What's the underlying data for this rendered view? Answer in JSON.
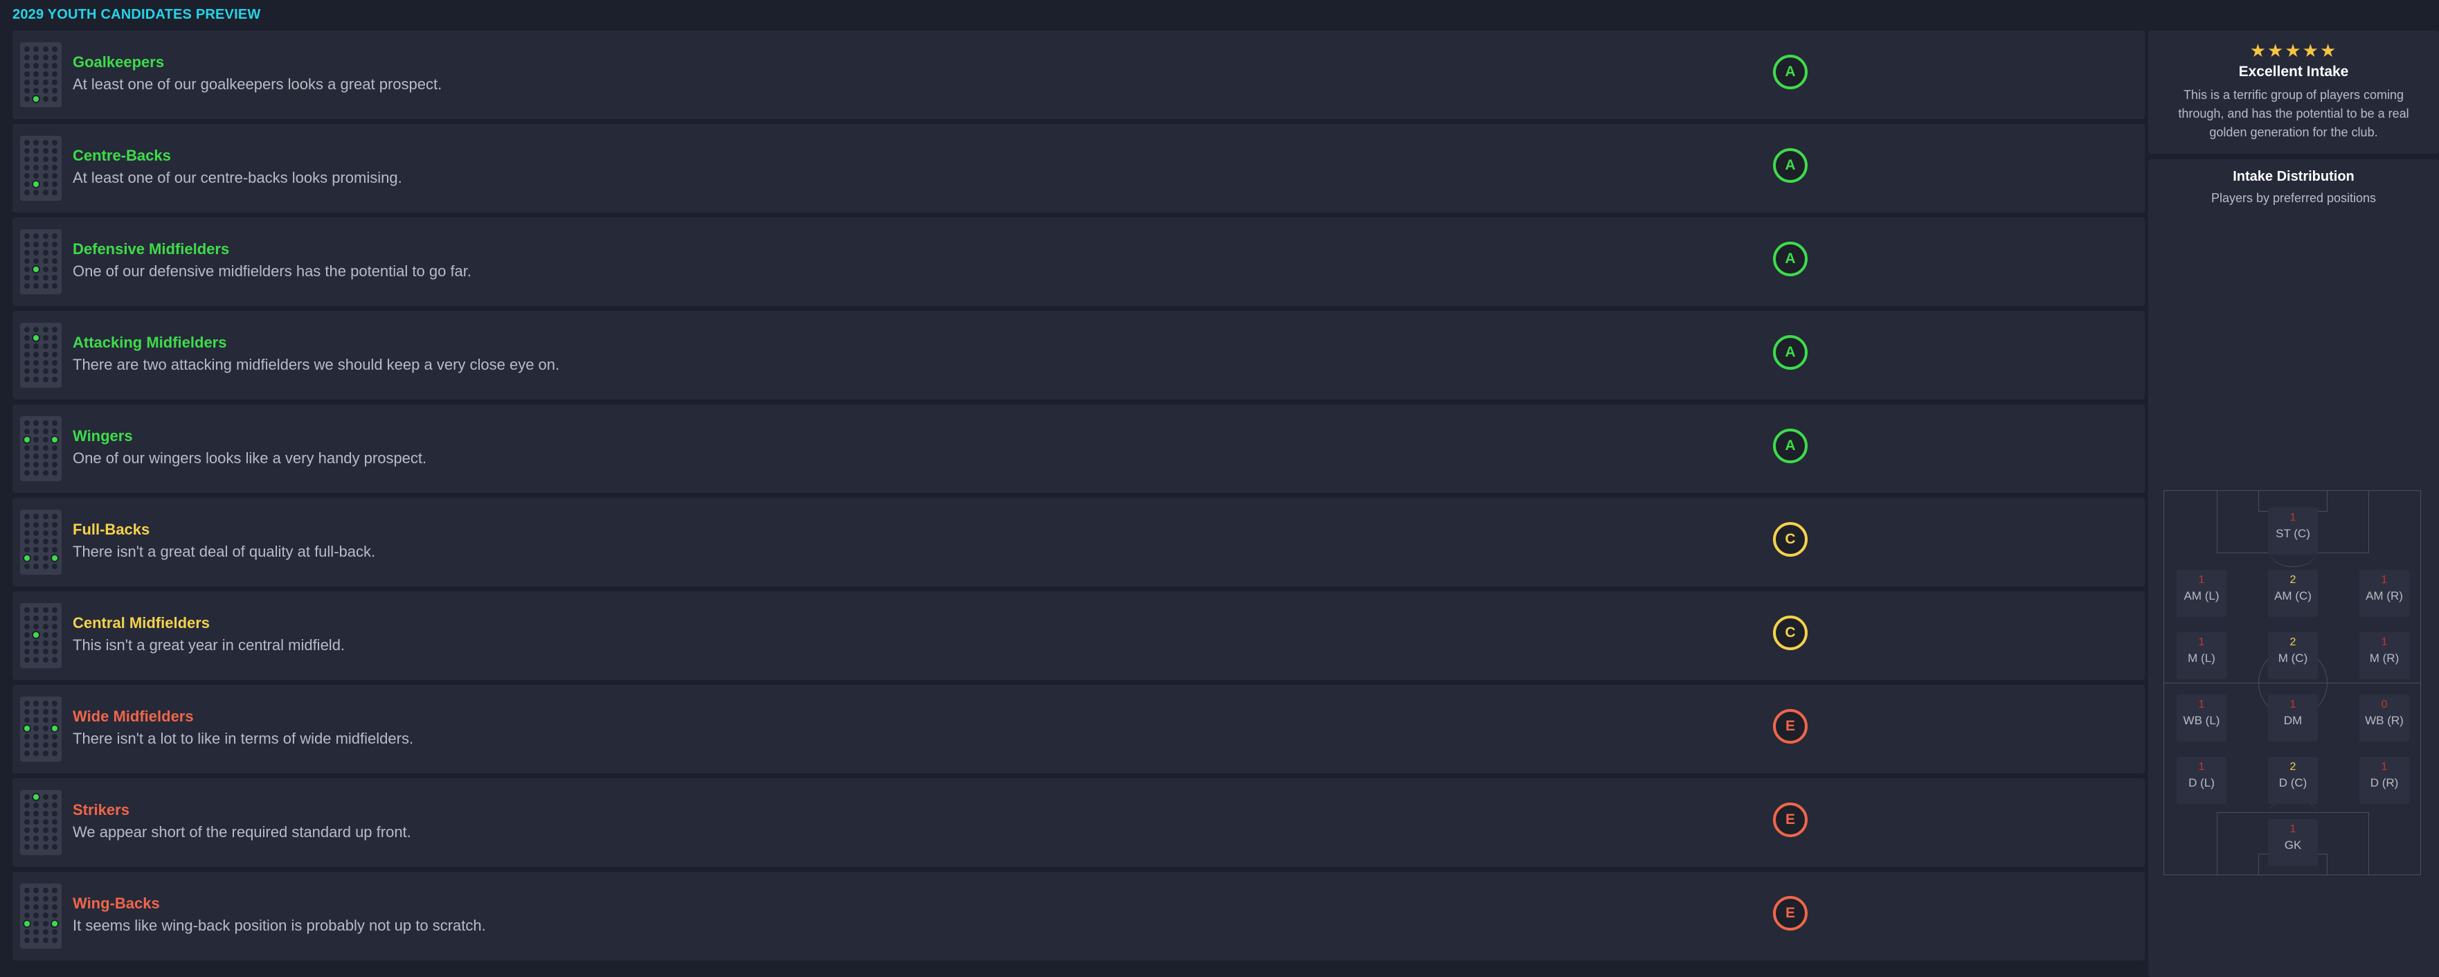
{
  "page_title": "2029 YOUTH CANDIDATES PREVIEW",
  "colors": {
    "green": "#3ddc4a",
    "yellow": "#f5d24b",
    "red": "#f0664a",
    "cyan": "#25d4e8"
  },
  "positions": [
    {
      "title": "Goalkeepers",
      "desc": "At least one of our goalkeepers looks a great prospect.",
      "grade": "A",
      "tone": "green",
      "icon": "pitch-gk-icon"
    },
    {
      "title": "Centre-Backs",
      "desc": "At least one of our centre-backs looks promising.",
      "grade": "A",
      "tone": "green",
      "icon": "pitch-cb-icon"
    },
    {
      "title": "Defensive Midfielders",
      "desc": "One of our defensive midfielders has the potential to go far.",
      "grade": "A",
      "tone": "green",
      "icon": "pitch-dm-icon"
    },
    {
      "title": "Attacking Midfielders",
      "desc": "There are two attacking midfielders we should keep a very close eye on.",
      "grade": "A",
      "tone": "green",
      "icon": "pitch-am-icon"
    },
    {
      "title": "Wingers",
      "desc": "One of our wingers looks like a very handy prospect.",
      "grade": "A",
      "tone": "green",
      "icon": "pitch-winger-icon"
    },
    {
      "title": "Full-Backs",
      "desc": "There isn't a great deal of quality at full-back.",
      "grade": "C",
      "tone": "yellow",
      "icon": "pitch-fb-icon"
    },
    {
      "title": "Central Midfielders",
      "desc": "This isn't a great year in central midfield.",
      "grade": "C",
      "tone": "yellow",
      "icon": "pitch-cm-icon"
    },
    {
      "title": "Wide Midfielders",
      "desc": "There isn't a lot to like in terms of wide midfielders.",
      "grade": "E",
      "tone": "red",
      "icon": "pitch-wm-icon"
    },
    {
      "title": "Strikers",
      "desc": "We appear short of the required standard up front.",
      "grade": "E",
      "tone": "red",
      "icon": "pitch-st-icon"
    },
    {
      "title": "Wing-Backs",
      "desc": "It seems like wing-back position is probably not up to scratch.",
      "grade": "E",
      "tone": "red",
      "icon": "pitch-wb-icon"
    }
  ],
  "intake": {
    "stars": "★★★★★",
    "rating": 5,
    "title": "Excellent Intake",
    "desc": "This is a terrific group of players coming through, and has the potential to be a real golden generation for the club."
  },
  "distribution": {
    "title": "Intake Distribution",
    "subtitle": "Players by preferred positions",
    "cells": [
      {
        "label": "ST (C)",
        "count": "1",
        "tone": "red"
      },
      {
        "label": "AM (L)",
        "count": "1",
        "tone": "red"
      },
      {
        "label": "AM (C)",
        "count": "2",
        "tone": "yellow"
      },
      {
        "label": "AM (R)",
        "count": "1",
        "tone": "red"
      },
      {
        "label": "M (L)",
        "count": "1",
        "tone": "red"
      },
      {
        "label": "M (C)",
        "count": "2",
        "tone": "yellow"
      },
      {
        "label": "M (R)",
        "count": "1",
        "tone": "red"
      },
      {
        "label": "WB (L)",
        "count": "1",
        "tone": "red"
      },
      {
        "label": "DM",
        "count": "1",
        "tone": "red"
      },
      {
        "label": "WB (R)",
        "count": "0",
        "tone": "red"
      },
      {
        "label": "D (L)",
        "count": "1",
        "tone": "red"
      },
      {
        "label": "D (C)",
        "count": "2",
        "tone": "yellow"
      },
      {
        "label": "D (R)",
        "count": "1",
        "tone": "red"
      },
      {
        "label": "GK",
        "count": "1",
        "tone": "red"
      }
    ]
  }
}
